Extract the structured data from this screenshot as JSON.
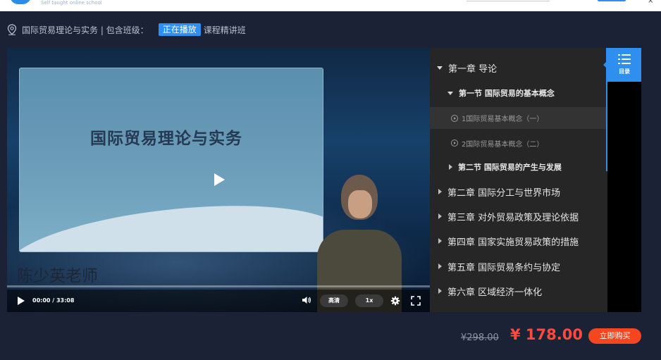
{
  "header": {
    "logo_subtitle": "Self taught online school"
  },
  "course": {
    "title_prefix": "国际贸易理论与实务 | 包含班级：",
    "badge": "正在播放",
    "class_name": "课程精讲班"
  },
  "player": {
    "slide_title": "国际贸易理论与实务",
    "teacher_name": "陈少英老师",
    "time": "00:00 / 33:08",
    "quality": "高清",
    "speed": "1x",
    "progress": 0
  },
  "catalog": {
    "tab_label": "目录",
    "items": [
      {
        "label": "第一章 导论",
        "level": "chapter",
        "expanded": true
      },
      {
        "label": "第一节 国际贸易的基本概念",
        "level": "section",
        "expanded": true
      },
      {
        "label": "1国际贸易基本概念（一）",
        "level": "lesson",
        "active": true
      },
      {
        "label": "2国际贸易基本概念（二）",
        "level": "lesson",
        "active": false
      },
      {
        "label": "第二节 国际贸易的产生与发展",
        "level": "section",
        "expanded": false
      },
      {
        "label": "第二章 国际分工与世界市场",
        "level": "chapter",
        "expanded": false
      },
      {
        "label": "第三章 对外贸易政策及理论依据",
        "level": "chapter",
        "expanded": false
      },
      {
        "label": "第四章 国家实施贸易政策的措施",
        "level": "chapter",
        "expanded": false
      },
      {
        "label": "第五章 国际贸易条约与协定",
        "level": "chapter",
        "expanded": false
      },
      {
        "label": "第六章 区域经济一体化",
        "level": "chapter",
        "expanded": false
      }
    ]
  },
  "pricing": {
    "old_price": "¥298.00",
    "new_price": "¥ 178.00",
    "buy_label": "立即购买"
  },
  "colors": {
    "accent": "#2e8ff0",
    "price": "#ff4a3d",
    "buy": "#f5461f",
    "background": "#1b2236"
  }
}
